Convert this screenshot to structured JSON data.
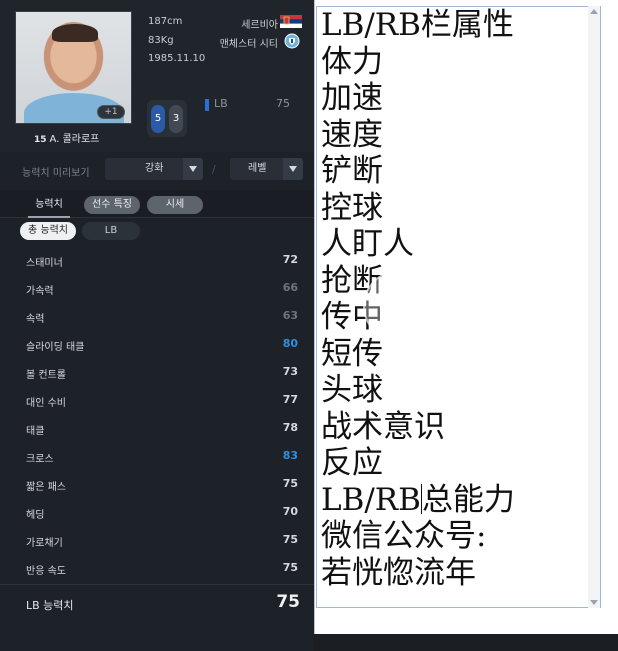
{
  "player": {
    "height": "187cm",
    "weight": "83Kg",
    "birthdate": "1985.11.10",
    "nationality": "세르비아",
    "club": "맨체스터 시티",
    "number": "15",
    "name": "A. 콜라로프",
    "plus_badge": "+1",
    "foot_left": "5",
    "foot_right": "3",
    "position": "LB",
    "position_rating": "75"
  },
  "controls": {
    "preview_label": "능력치 미리보기",
    "enhance_label": "강화",
    "slash": "/",
    "level_label": "레벨"
  },
  "tabs": {
    "stats": "능력치",
    "traits": "선수 특징",
    "market": "시세"
  },
  "subtabs": {
    "total": "총 능력치",
    "lb": "LB"
  },
  "stats": [
    {
      "label": "스태미너",
      "value": "72",
      "color": "#d6dade"
    },
    {
      "label": "가속력",
      "value": "66",
      "color": "#6d757e"
    },
    {
      "label": "속력",
      "value": "63",
      "color": "#6d757e"
    },
    {
      "label": "슬라이딩 태클",
      "value": "80",
      "color": "#2f8fe0"
    },
    {
      "label": "볼 컨트롤",
      "value": "73",
      "color": "#d6dade"
    },
    {
      "label": "대인 수비",
      "value": "77",
      "color": "#d6dade"
    },
    {
      "label": "태클",
      "value": "78",
      "color": "#d6dade"
    },
    {
      "label": "크로스",
      "value": "83",
      "color": "#2f8fe0"
    },
    {
      "label": "짧은 패스",
      "value": "75",
      "color": "#d6dade"
    },
    {
      "label": "헤딩",
      "value": "70",
      "color": "#d6dade"
    },
    {
      "label": "가로채기",
      "value": "75",
      "color": "#d6dade"
    },
    {
      "label": "반응 속도",
      "value": "75",
      "color": "#d6dade"
    }
  ],
  "total": {
    "label": "LB 능력치",
    "value": "75"
  },
  "editor": {
    "lines": [
      "LB/RB栏属性",
      "体力",
      "加速",
      "速度",
      "铲断",
      "控球",
      "人盯人",
      "抢断",
      "传中",
      "短传",
      "头球",
      "战术意识",
      "反应",
      "LB/RB总能力",
      "微信公众号:",
      "若恍惚流年"
    ],
    "caret_line": 13,
    "caret_after": "LB/RB"
  }
}
